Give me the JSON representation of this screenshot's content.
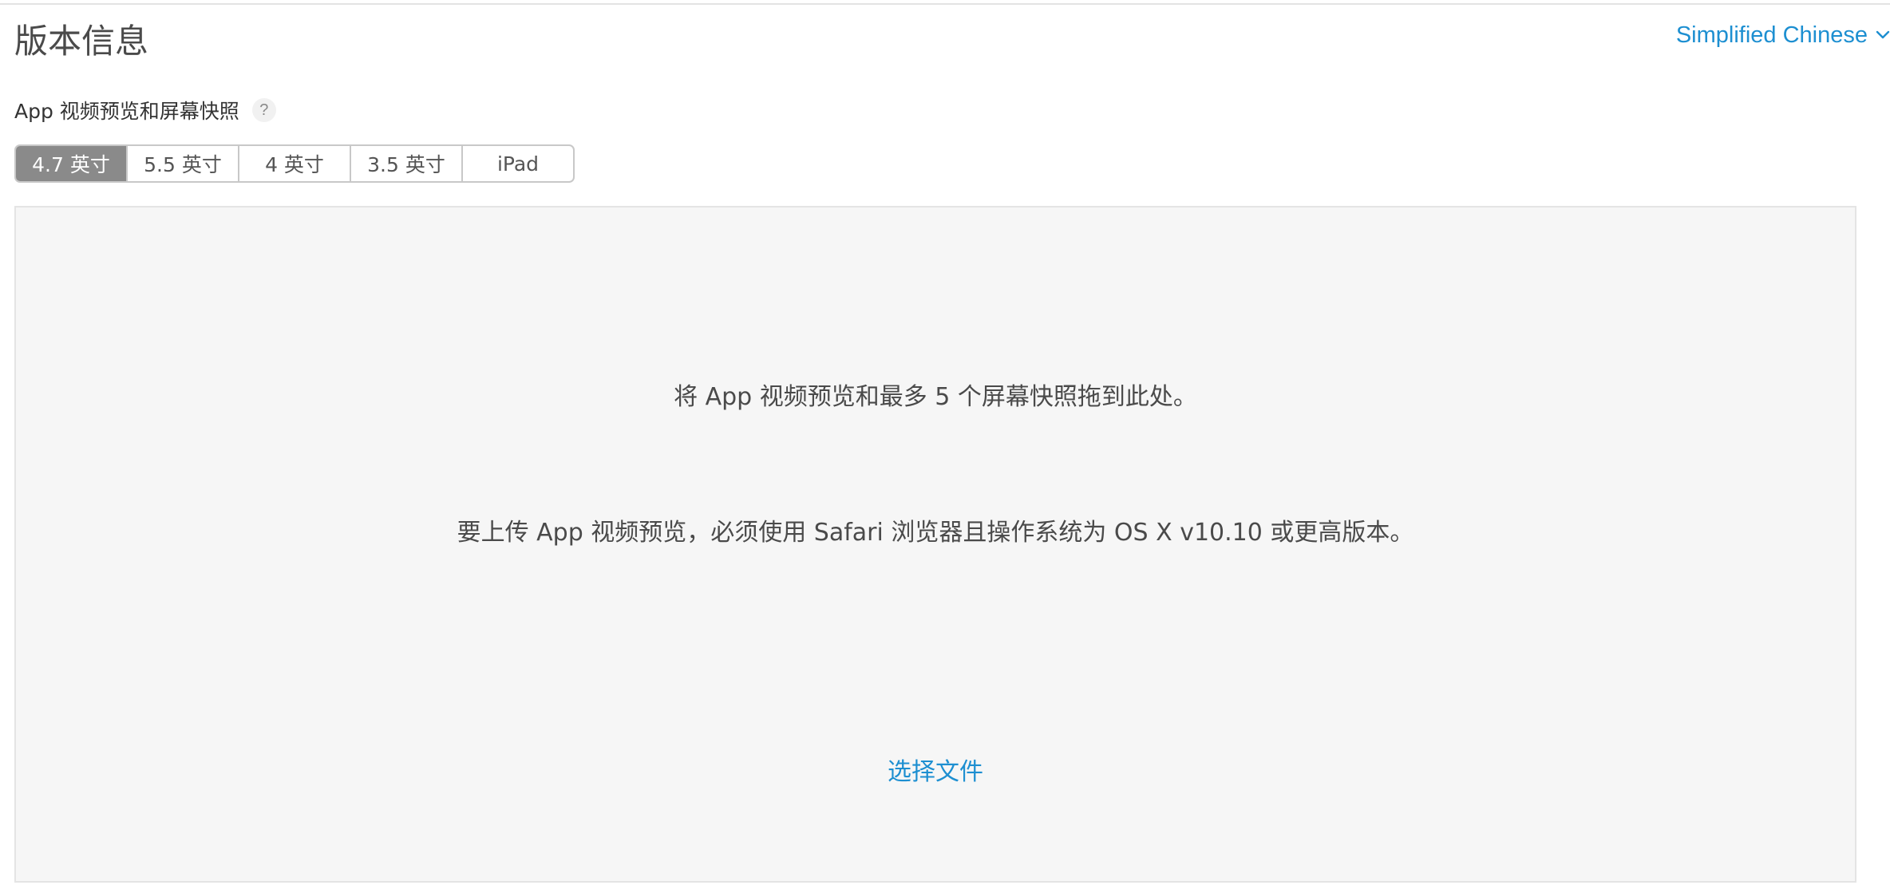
{
  "page": {
    "title": "版本信息"
  },
  "language": {
    "selected": "Simplified Chinese",
    "icon": "chevron-down-icon",
    "accent_color": "#1d8fd1"
  },
  "media_section": {
    "label": "App 视频预览和屏幕快照",
    "help_glyph": "?",
    "tabs": [
      {
        "label": "4.7 英寸",
        "active": true
      },
      {
        "label": "5.5 英寸",
        "active": false
      },
      {
        "label": "4 英寸",
        "active": false
      },
      {
        "label": "3.5 英寸",
        "active": false
      },
      {
        "label": "iPad",
        "active": false
      }
    ],
    "active_tab_color": "#8a8a8a"
  },
  "dropzone": {
    "instruction": "将 App 视频预览和最多 5 个屏幕快照拖到此处。",
    "requirement": "要上传 App 视频预览，必须使用 Safari 浏览器且操作系统为 OS X v10.10 或更高版本。",
    "choose_file_label": "选择文件"
  }
}
